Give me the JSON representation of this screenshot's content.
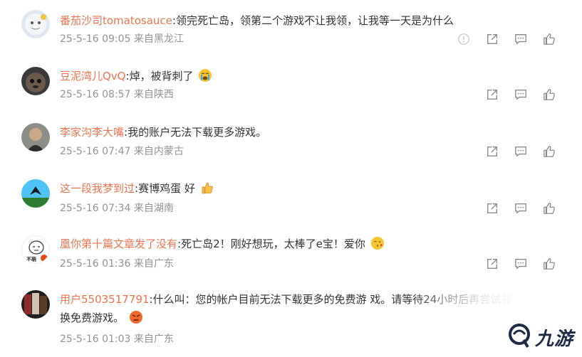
{
  "comments": [
    {
      "user": "番茄沙司tomatosauce",
      "text": ":领完死亡岛，领第二个游戏不让我领，让我等一天是为什么",
      "time": "25-5-16 09:05",
      "location": "来自黑龙江",
      "report": true
    },
    {
      "user": "豆泥湾儿QvQ",
      "text": ":焯，被背刺了",
      "time": "25-5-16 08:57",
      "location": "来自陕西",
      "emoji": "crying-face"
    },
    {
      "user": "李家沟李大嘴",
      "text": ":我的账户无法下载更多游戏。",
      "time": "25-5-16 07:47",
      "location": "来自内蒙古"
    },
    {
      "user": "这一段我梦到过",
      "text": ":赛博鸡蛋 好",
      "time": "25-5-16 07:34",
      "location": "来自湖南",
      "emoji": "thumbs-up"
    },
    {
      "user": "凰你第十篇文章发了没有",
      "text": ":死亡岛2！刚好想玩，太棒了e宝！爱你",
      "time": "25-5-16 01:36",
      "location": "来自广东",
      "emoji": "kiss-face",
      "avatar_text": "不萌"
    },
    {
      "user": "用户5503517791",
      "text": ":什么叫：您的帐户目前无法下载更多的免费游 戏。请等待24小时后再尝试兑",
      "text2": "换免费游戏。",
      "time": "25-5-16 01:03",
      "location": "来自广东",
      "emoji": "angry-face"
    }
  ],
  "watermark": {
    "text": "九游"
  },
  "colors": {
    "username": "#eb7350",
    "meta": "#939393",
    "text": "#333333",
    "icon": "#8a8a8a"
  }
}
